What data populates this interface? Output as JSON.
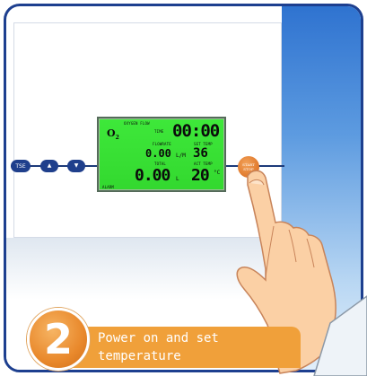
{
  "buttons": {
    "left1": "TSE",
    "left2": "▲",
    "left3": "▼"
  },
  "lcd": {
    "gas": "O",
    "gas_sub": "2",
    "header_left": "OXYGEN FLOW",
    "header_mid": "TIME",
    "time": "00:00",
    "label_flowrate": "FLOWRATE",
    "label_set_temp": "SET TEMP",
    "flow_value": "0.00",
    "flow_unit": "L/M",
    "set_temp": "36",
    "label_total": "TOTAL",
    "label_act_temp": "ACT TEMP",
    "total_value": "0.00",
    "total_unit": "L",
    "act_temp": "20",
    "act_unit": "°C",
    "bottom_left": "ALARM"
  },
  "start_button": {
    "line1": "START",
    "line2": "STOP"
  },
  "step": {
    "number": "2",
    "line1": "Power on and set",
    "line2": "temperature"
  },
  "colors": {
    "lcd_green": "#3ee83a",
    "banner_orange": "#f0a03a",
    "control_blue": "#1f3f8c",
    "frame_blue": "#1d3f8f"
  }
}
